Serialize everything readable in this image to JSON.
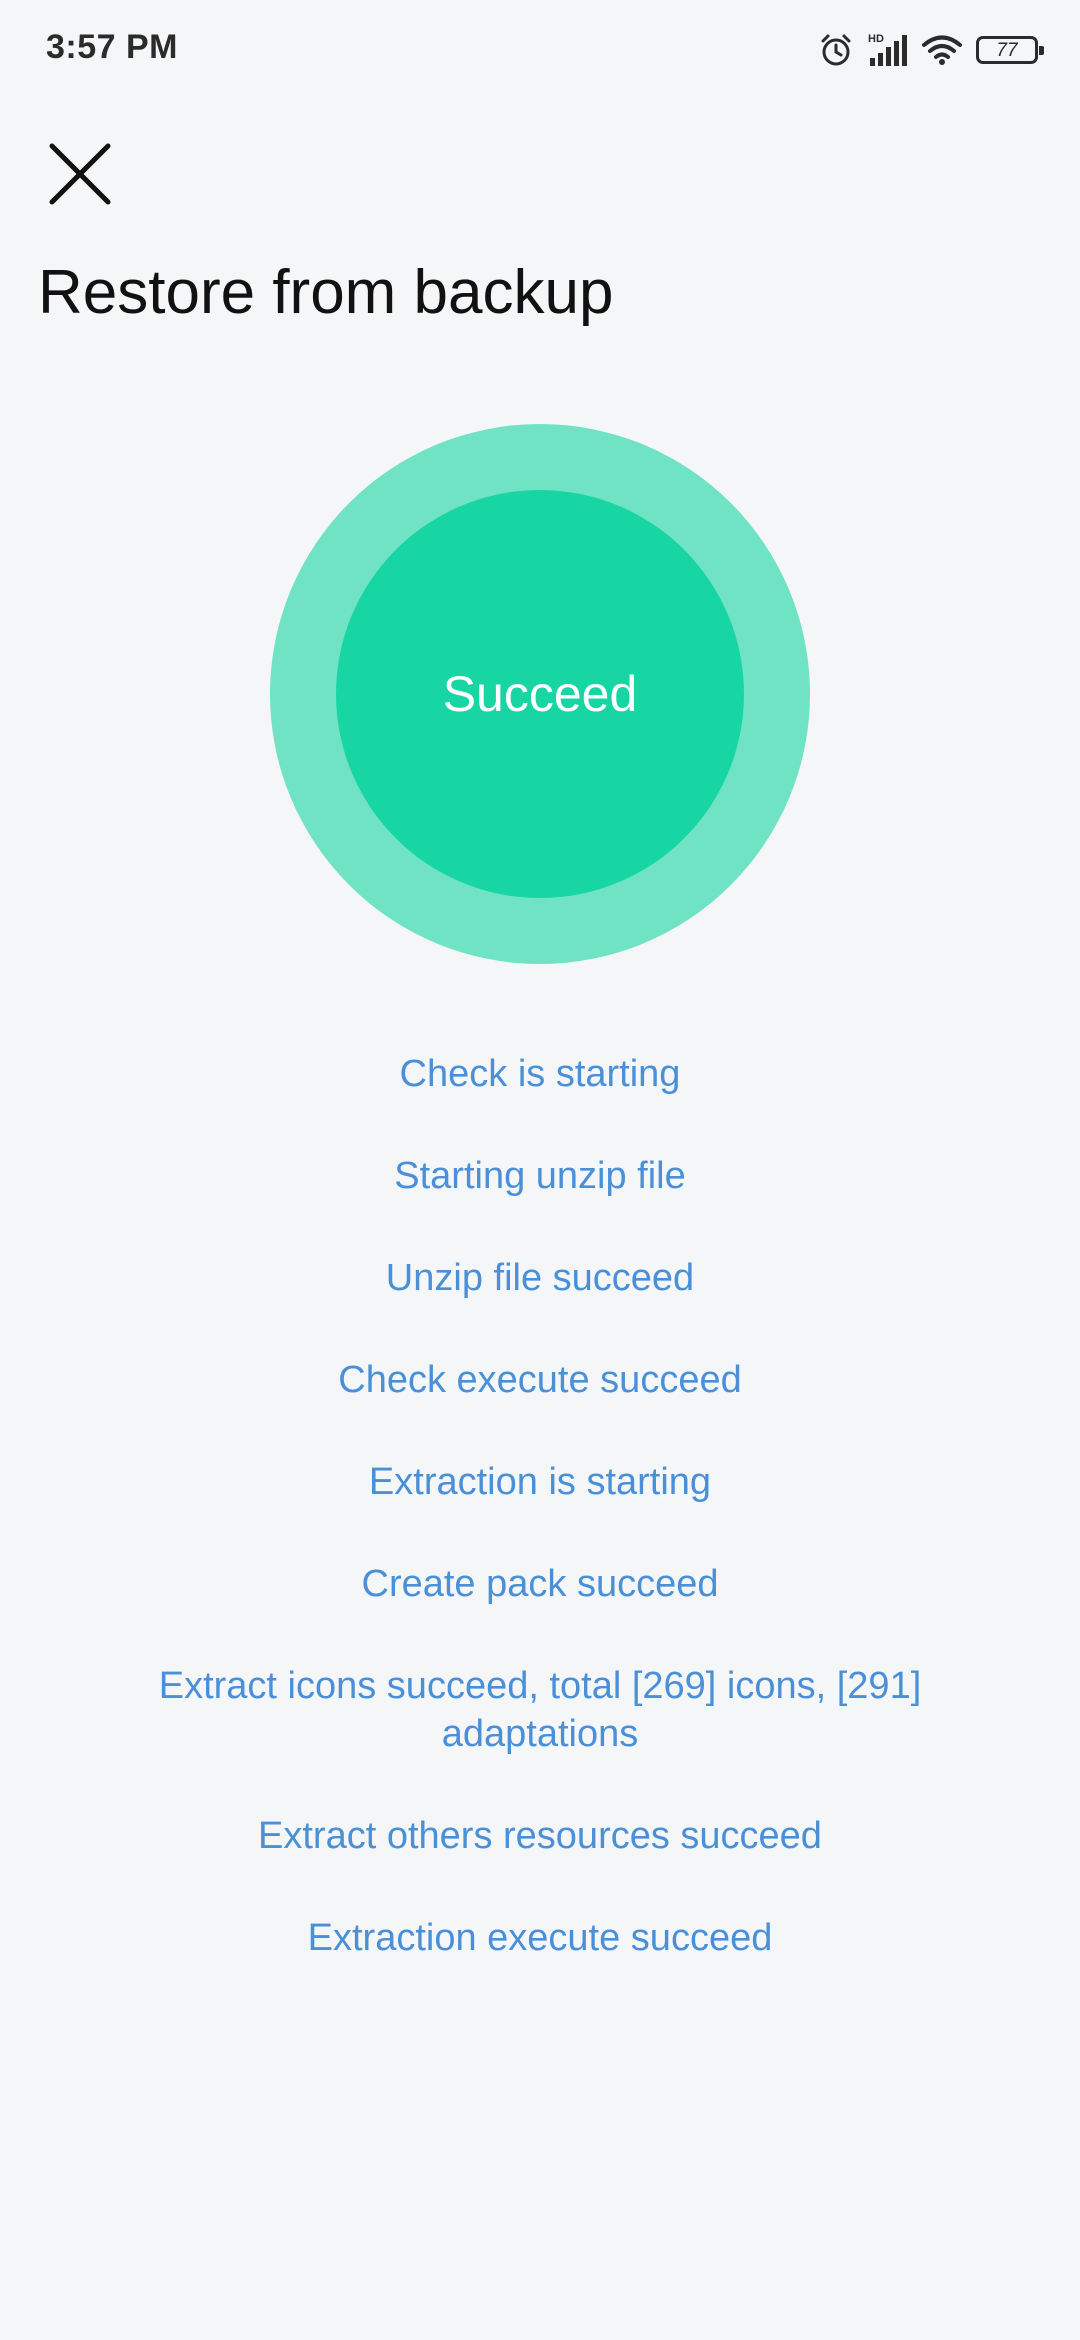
{
  "status_bar": {
    "time": "3:57 PM",
    "battery_level": "77",
    "icons": [
      "alarm-icon",
      "hd-signal-icon",
      "wifi-icon",
      "battery-icon"
    ]
  },
  "header": {
    "close_icon": "close-icon",
    "title": "Restore from backup"
  },
  "status": {
    "label": "Succeed",
    "colors": {
      "outer_ring": "#70e3c5",
      "inner_fill": "#18d6a3",
      "text": "#ffffff"
    }
  },
  "log": {
    "color": "#4a90d9",
    "items": [
      "Check is starting",
      "Starting unzip file",
      "Unzip file succeed",
      "Check execute succeed",
      "Extraction is starting",
      "Create pack succeed",
      "Extract icons succeed, total [269] icons, [291] adaptations",
      "Extract others resources succeed",
      "Extraction execute succeed"
    ]
  }
}
